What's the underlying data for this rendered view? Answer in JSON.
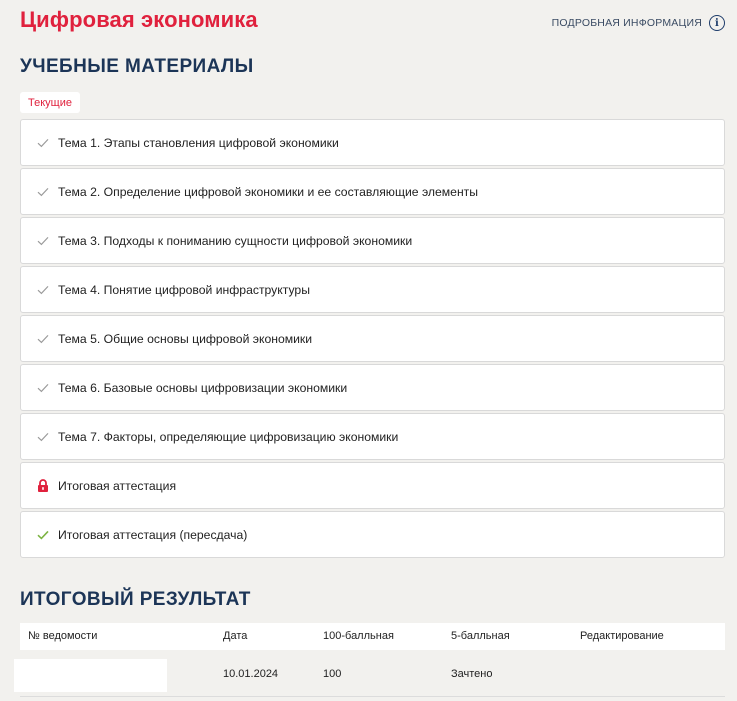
{
  "course": {
    "title": "Цифровая экономика",
    "info_link": "ПОДРОБНАЯ ИНФОРМАЦИЯ",
    "info_icon": "info-icon"
  },
  "materials": {
    "heading": "УЧЕБНЫЕ МАТЕРИАЛЫ",
    "current_tab": "Текущие",
    "items": [
      {
        "label": "Тема 1. Этапы становления цифровой экономики",
        "status": "done"
      },
      {
        "label": "Тема 2. Определение цифровой экономики и ее составляющие элементы",
        "status": "done"
      },
      {
        "label": "Тема 3. Подходы к пониманию сущности цифровой экономики",
        "status": "done"
      },
      {
        "label": "Тема 4. Понятие цифровой инфраструктуры",
        "status": "done"
      },
      {
        "label": "Тема 5. Общие основы цифровой экономики",
        "status": "done"
      },
      {
        "label": "Тема 6. Базовые основы цифровизации экономики",
        "status": "done"
      },
      {
        "label": "Тема 7. Факторы, определяющие цифровизацию экономики",
        "status": "done"
      },
      {
        "label": "Итоговая аттестация",
        "status": "locked"
      },
      {
        "label": "Итоговая аттестация (пересдача)",
        "status": "passed"
      }
    ]
  },
  "results": {
    "heading": "ИТОГОВЫЙ РЕЗУЛЬТАТ",
    "columns": [
      "№ ведомости",
      "Дата",
      "100-балльная",
      "5-балльная",
      "Редактирование"
    ],
    "rows": [
      {
        "number": "",
        "date": "10.01.2024",
        "score100": "100",
        "score5": "Зачтено",
        "edit": ""
      }
    ]
  },
  "colors": {
    "accent": "#e0213d",
    "heading": "#1c3557",
    "check_done": "#9a9a9a",
    "check_passed": "#7cb342",
    "lock": "#e0213d"
  }
}
